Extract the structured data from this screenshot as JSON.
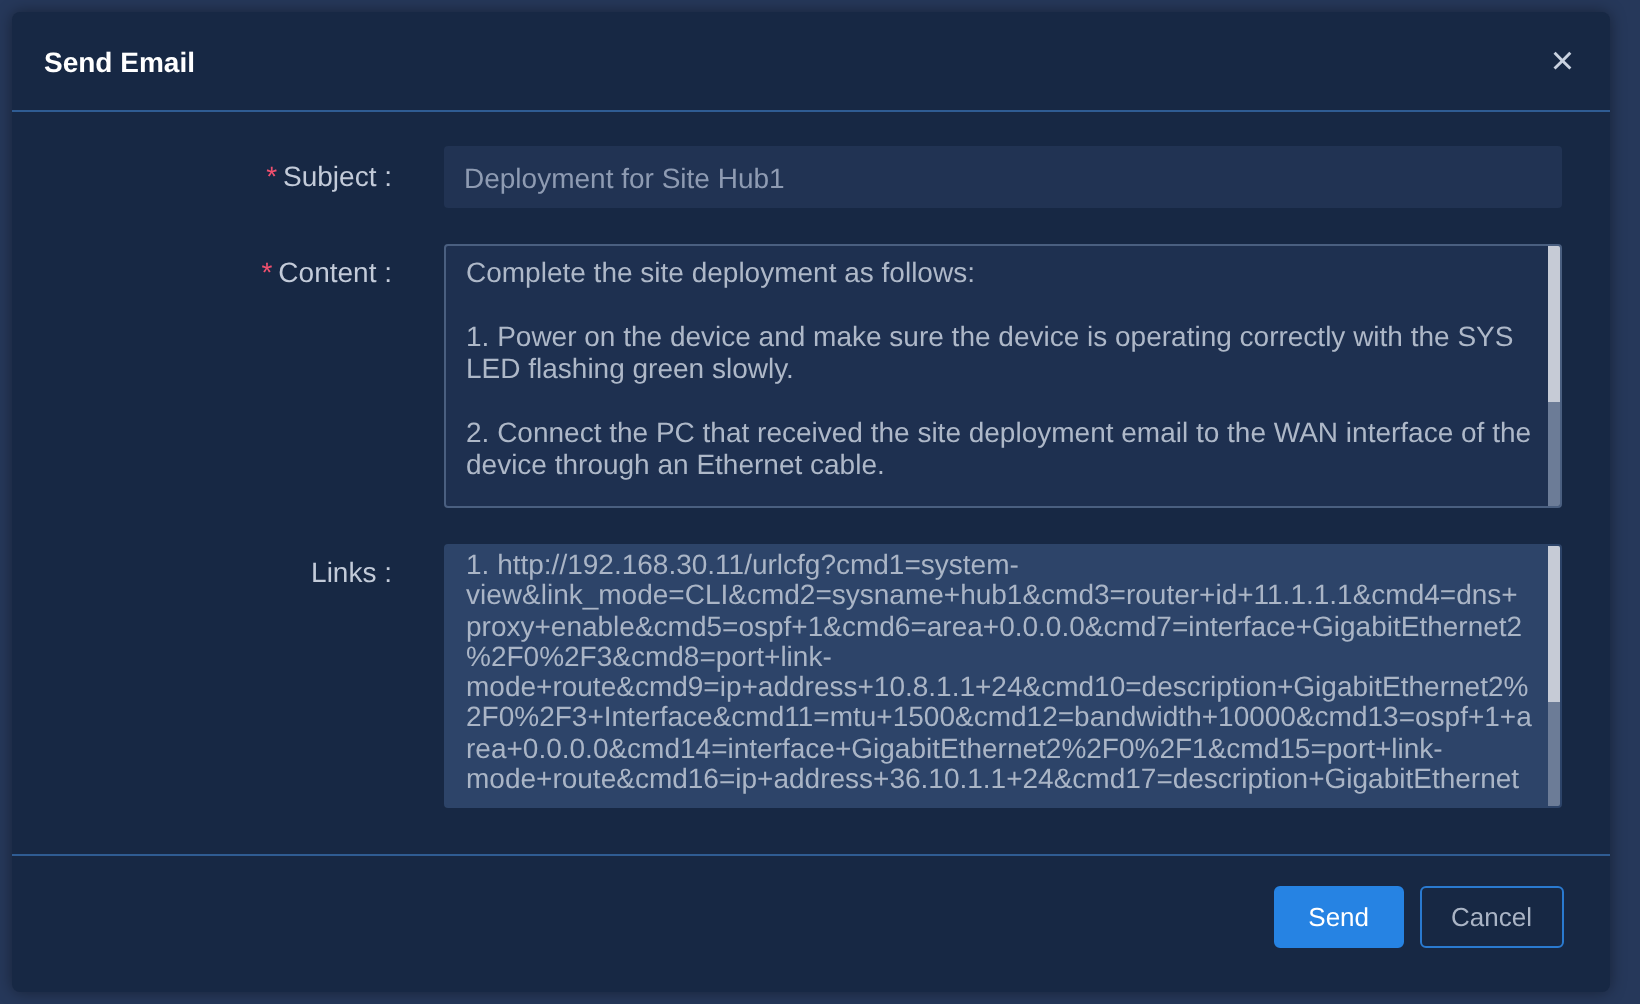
{
  "dialog": {
    "title": "Send Email",
    "close": "×"
  },
  "fields": [
    {
      "kind": "input",
      "label": "Subject :",
      "required_mark": "*",
      "value": "Deployment for Site Hub1"
    },
    {
      "kind": "textarea",
      "label": "Content :",
      "required_mark": "*",
      "paragraphs": [
        "Complete the site deployment as follows:",
        "1. Power on the device and make sure the device is operating correctly with the SYS LED flashing green slowly.",
        "2. Connect the PC that received the site deployment email to the WAN interface of the device through an Ethernet cable."
      ]
    },
    {
      "kind": "links",
      "label": "Links :",
      "paragraphs": [
        "1. http://192.168.30.11/urlcfg?cmd1=system-view&link_mode=CLI&cmd2=sysname+hub1&cmd3=router+id+11.1.1.1&cmd4=dns+proxy+enable&cmd5=ospf+1&cmd6=area+0.0.0.0&cmd7=interface+GigabitEthernet2%2F0%2F3&cmd8=port+link-mode+route&cmd9=ip+address+10.8.1.1+24&cmd10=description+GigabitEthernet2%2F0%2F3+Interface&cmd11=mtu+1500&cmd12=bandwidth+10000&cmd13=ospf+1+area+0.0.0.0&cmd14=interface+GigabitEthernet2%2F0%2F1&cmd15=port+link-mode+route&cmd16=ip+address+36.10.1.1+24&cmd17=description+GigabitEthernet"
      ]
    }
  ],
  "buttons": [
    {
      "kind": "primary",
      "label": "Send"
    },
    {
      "kind": "secondary",
      "label": "Cancel"
    }
  ]
}
